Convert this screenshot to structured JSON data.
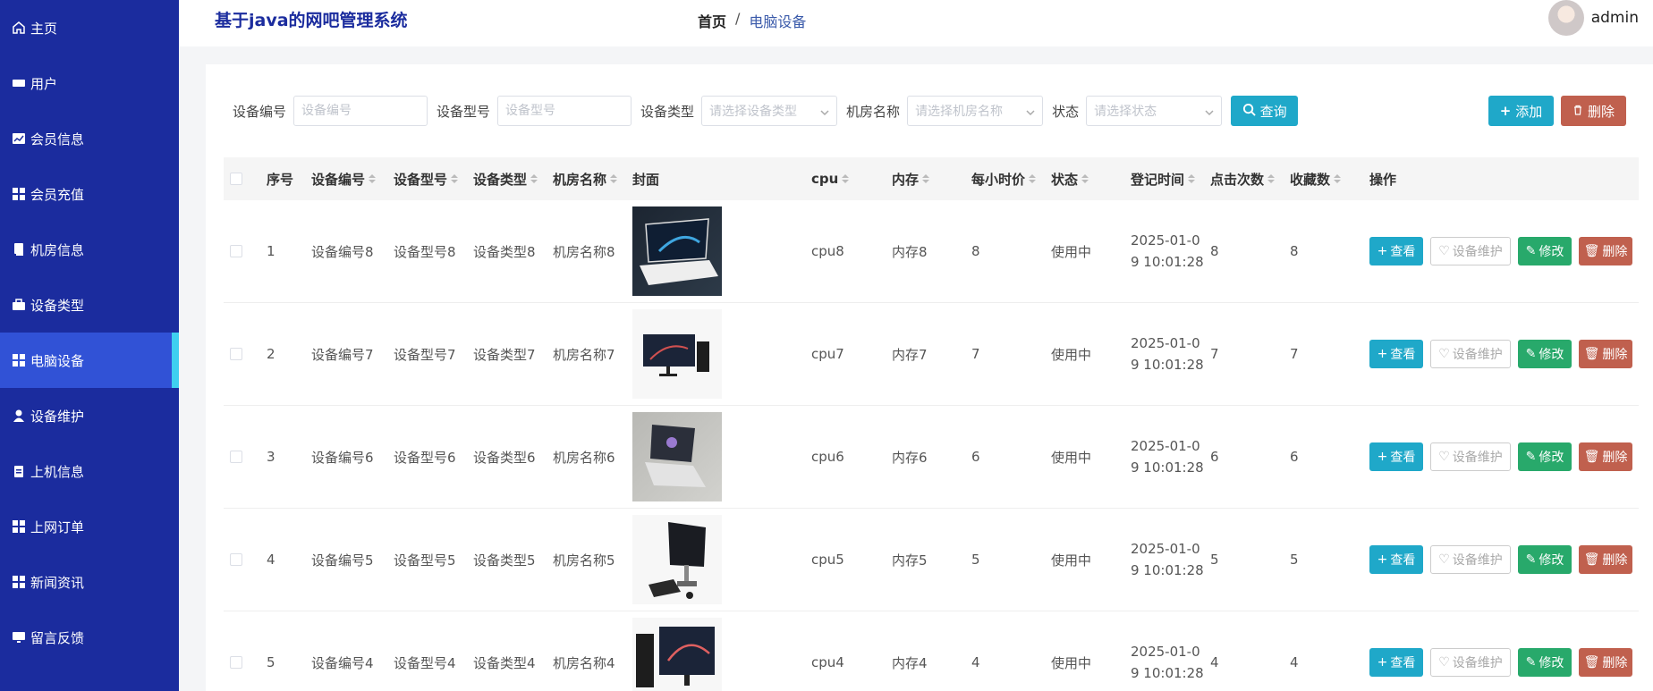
{
  "app": {
    "title": "基于java的网吧管理系统"
  },
  "breadcrumb": {
    "home": "首页",
    "separator": "/",
    "current": "电脑设备"
  },
  "user": {
    "name": "admin"
  },
  "sidebar": {
    "items": [
      {
        "label": "主页",
        "icon": "home-icon"
      },
      {
        "label": "用户",
        "icon": "user-card-icon"
      },
      {
        "label": "会员信息",
        "icon": "chart-icon"
      },
      {
        "label": "会员充值",
        "icon": "grid-icon"
      },
      {
        "label": "机房信息",
        "icon": "book-icon"
      },
      {
        "label": "设备类型",
        "icon": "briefcase-icon"
      },
      {
        "label": "电脑设备",
        "icon": "grid-icon",
        "active": true
      },
      {
        "label": "设备维护",
        "icon": "person-icon"
      },
      {
        "label": "上机信息",
        "icon": "clipboard-icon"
      },
      {
        "label": "上网订单",
        "icon": "grid-icon"
      },
      {
        "label": "新闻资讯",
        "icon": "grid-icon"
      },
      {
        "label": "留言反馈",
        "icon": "monitor-icon"
      }
    ]
  },
  "search": {
    "device_no_label": "设备编号",
    "device_no_placeholder": "设备编号",
    "device_model_label": "设备型号",
    "device_model_placeholder": "设备型号",
    "device_type_label": "设备类型",
    "device_type_placeholder": "请选择设备类型",
    "room_label": "机房名称",
    "room_placeholder": "请选择机房名称",
    "status_label": "状态",
    "status_placeholder": "请选择状态",
    "query_label": "查询"
  },
  "toolbar": {
    "add_label": "添加",
    "delete_label": "删除"
  },
  "table": {
    "headers": {
      "idx": "序号",
      "no": "设备编号",
      "model": "设备型号",
      "type": "设备类型",
      "room": "机房名称",
      "cover": "封面",
      "cpu": "cpu",
      "mem": "内存",
      "price": "每小时价",
      "status": "状态",
      "time": "登记时间",
      "clicks": "点击次数",
      "fav": "收藏数",
      "ops": "操作"
    },
    "rows": [
      {
        "idx": "1",
        "no": "设备编号8",
        "model": "设备型号8",
        "type": "设备类型8",
        "room": "机房名称8",
        "cpu": "cpu8",
        "mem": "内存8",
        "price": "8",
        "status": "使用中",
        "time": "2025-01-09 10:01:28",
        "clicks": "8",
        "fav": "8"
      },
      {
        "idx": "2",
        "no": "设备编号7",
        "model": "设备型号7",
        "type": "设备类型7",
        "room": "机房名称7",
        "cpu": "cpu7",
        "mem": "内存7",
        "price": "7",
        "status": "使用中",
        "time": "2025-01-09 10:01:28",
        "clicks": "7",
        "fav": "7"
      },
      {
        "idx": "3",
        "no": "设备编号6",
        "model": "设备型号6",
        "type": "设备类型6",
        "room": "机房名称6",
        "cpu": "cpu6",
        "mem": "内存6",
        "price": "6",
        "status": "使用中",
        "time": "2025-01-09 10:01:28",
        "clicks": "6",
        "fav": "6"
      },
      {
        "idx": "4",
        "no": "设备编号5",
        "model": "设备型号5",
        "type": "设备类型5",
        "room": "机房名称5",
        "cpu": "cpu5",
        "mem": "内存5",
        "price": "5",
        "status": "使用中",
        "time": "2025-01-09 10:01:28",
        "clicks": "5",
        "fav": "5"
      },
      {
        "idx": "5",
        "no": "设备编号4",
        "model": "设备型号4",
        "type": "设备类型4",
        "room": "机房名称4",
        "cpu": "cpu4",
        "mem": "内存4",
        "price": "4",
        "status": "使用中",
        "time": "2025-01-09 10:01:28",
        "clicks": "4",
        "fav": "4"
      }
    ],
    "row_actions": {
      "view": "查看",
      "maintain": "设备维护",
      "edit": "修改",
      "delete": "删除"
    }
  }
}
